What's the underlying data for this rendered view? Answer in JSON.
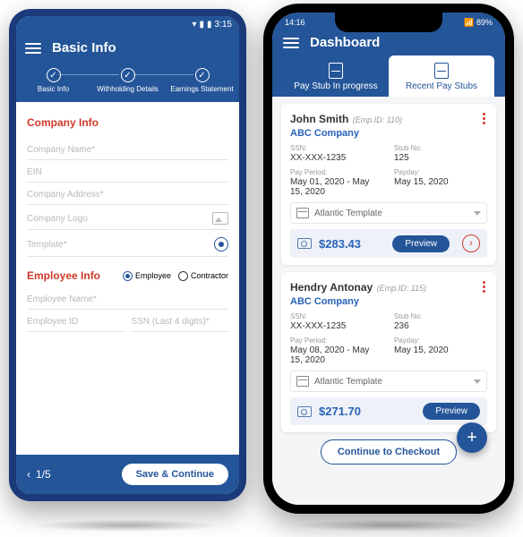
{
  "android": {
    "status": {
      "time": "3:15"
    },
    "title": "Basic Info",
    "steps": [
      "Basic Info",
      "Withholding Details",
      "Earnings Statement"
    ],
    "companyInfo": {
      "title": "Company Info",
      "fields": {
        "companyName": "Company Name*",
        "ein": "EIN",
        "address": "Company Address*",
        "logo": "Company Logo",
        "template": "Template*"
      }
    },
    "employeeInfo": {
      "title": "Employee Info",
      "radios": {
        "employee": "Employee",
        "contractor": "Contractor"
      },
      "fields": {
        "employeeName": "Employee Name*",
        "employeeId": "Employee ID",
        "ssn": "SSN (Last 4 digits)*"
      }
    },
    "footer": {
      "page": "1/5",
      "saveBtn": "Save & Continue"
    }
  },
  "ios": {
    "status": {
      "signal": "14:16",
      "battery": "89%"
    },
    "title": "Dashboard",
    "tabs": {
      "inProgress": "Pay Stub In progress",
      "recent": "Recent Pay Stubs"
    },
    "cards": [
      {
        "name": "John Smith",
        "empId": "(Emp.ID: 110)",
        "company": "ABC Company",
        "ssnLabel": "SSN:",
        "ssn": "XX-XXX-1235",
        "stubNoLabel": "Stub No:",
        "stubNo": "125",
        "periodLabel": "Pay Period:",
        "period": "May 01, 2020 - May 15, 2020",
        "paydayLabel": "Payday:",
        "payday": "May 15, 2020",
        "template": "Atlantic Template",
        "amount": "$283.43",
        "previewBtn": "Preview"
      },
      {
        "name": "Hendry Antonay",
        "empId": "(Emp.ID: 115)",
        "company": "ABC Company",
        "ssnLabel": "SSN:",
        "ssn": "XX-XXX-1235",
        "stubNoLabel": "Stub No:",
        "stubNo": "236",
        "periodLabel": "Pay Period:",
        "period": "May 08, 2020 - May 15, 2020",
        "paydayLabel": "Payday:",
        "payday": "May 15, 2020",
        "template": "Atlantic Template",
        "amount": "$271.70",
        "previewBtn": "Preview"
      }
    ],
    "checkoutBtn": "Continue to Checkout"
  }
}
